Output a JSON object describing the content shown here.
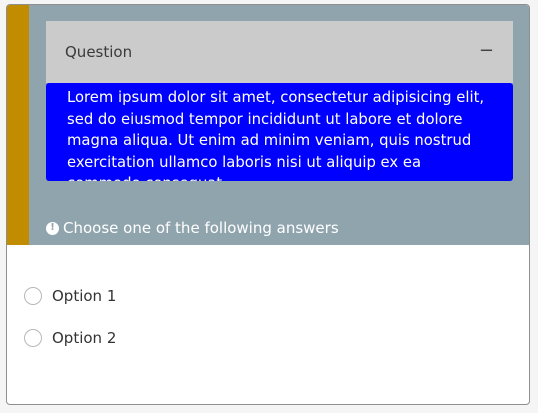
{
  "question": {
    "header_label": "Question",
    "collapse_symbol": "−",
    "body_text": "Lorem ipsum dolor sit amet, consectetur adipisicing elit, sed do eiusmod tempor incididunt ut labore et dolore magna aliqua. Ut enim ad minim veniam, quis nostrud exercitation ullamco laboris nisi ut aliquip ex ea commodo consequat."
  },
  "instruction": {
    "icon": "!",
    "text": "Choose one of the following answers"
  },
  "options": [
    {
      "label": "Option 1"
    },
    {
      "label": "Option 2"
    }
  ],
  "colors": {
    "accent": "#c28c00",
    "question_panel": "#90a4ad",
    "header": "#cbcbcb",
    "body_highlight": "#0000ff"
  }
}
